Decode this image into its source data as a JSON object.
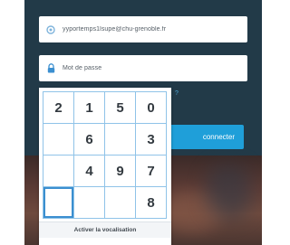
{
  "login": {
    "email_value": "yyportemps1lsupe@chu-grenoble.fr",
    "password_placeholder": "Mot de passe",
    "forgot_link": "?",
    "connect_label": "connecter"
  },
  "keypad": {
    "keys": [
      "2",
      "1",
      "5",
      "0",
      "",
      "6",
      "",
      "3",
      "",
      "4",
      "9",
      "7",
      "",
      "",
      "",
      "8"
    ],
    "vocalisation_label": "Activer la vocalisation"
  },
  "icons": {
    "email_field": "at-icon",
    "password_field": "lock-icon"
  },
  "colors": {
    "panel_bg": "#223a48",
    "accent": "#1f9fd9",
    "keypad_border": "#8fc3e8"
  }
}
